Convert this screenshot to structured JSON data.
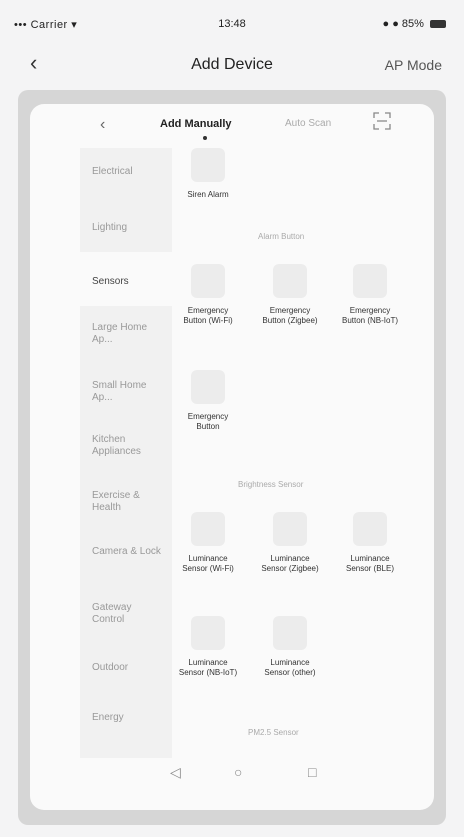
{
  "status_bar": {
    "signal": "••• Carrier ▾",
    "time": "13:48",
    "battery": "● ● 85%"
  },
  "nav": {
    "back": "‹",
    "title": "Add Device",
    "ap_mode": "AP Mode"
  },
  "tabs": {
    "back": "‹",
    "add_manually": "Add Manually",
    "auto_scan": "Auto Scan",
    "scan_icon": "scan-icon"
  },
  "sidebar": {
    "items": [
      {
        "label": "Electrical"
      },
      {
        "label": "Lighting"
      },
      {
        "label": "Sensors"
      },
      {
        "label": "Large Home Ap..."
      },
      {
        "label": "Small Home Ap..."
      },
      {
        "label": "Kitchen Appliances"
      },
      {
        "label": "Exercise & Health"
      },
      {
        "label": "Camera & Lock"
      },
      {
        "label": "Gateway Control"
      },
      {
        "label": "Outdoor"
      },
      {
        "label": "Energy"
      }
    ],
    "active_index": 2
  },
  "content": {
    "top_item": {
      "label": "Siren Alarm"
    },
    "section1_title": "Alarm Button",
    "section1_items": [
      {
        "label": "Emergency Button (Wi-Fi)"
      },
      {
        "label": "Emergency Button (Zigbee)"
      },
      {
        "label": "Emergency Button (NB-IoT)"
      },
      {
        "label": "Emergency Button"
      }
    ],
    "section2_title": "Brightness Sensor",
    "section2_items": [
      {
        "label": "Luminance Sensor (Wi-Fi)"
      },
      {
        "label": "Luminance Sensor (Zigbee)"
      },
      {
        "label": "Luminance Sensor (BLE)"
      },
      {
        "label": "Luminance Sensor (NB-IoT)"
      },
      {
        "label": "Luminance Sensor (other)"
      }
    ],
    "section3_title": "PM2.5 Sensor"
  },
  "bottom_nav": {
    "back_icon": "◁",
    "home_icon": "○",
    "recent_icon": "□"
  }
}
